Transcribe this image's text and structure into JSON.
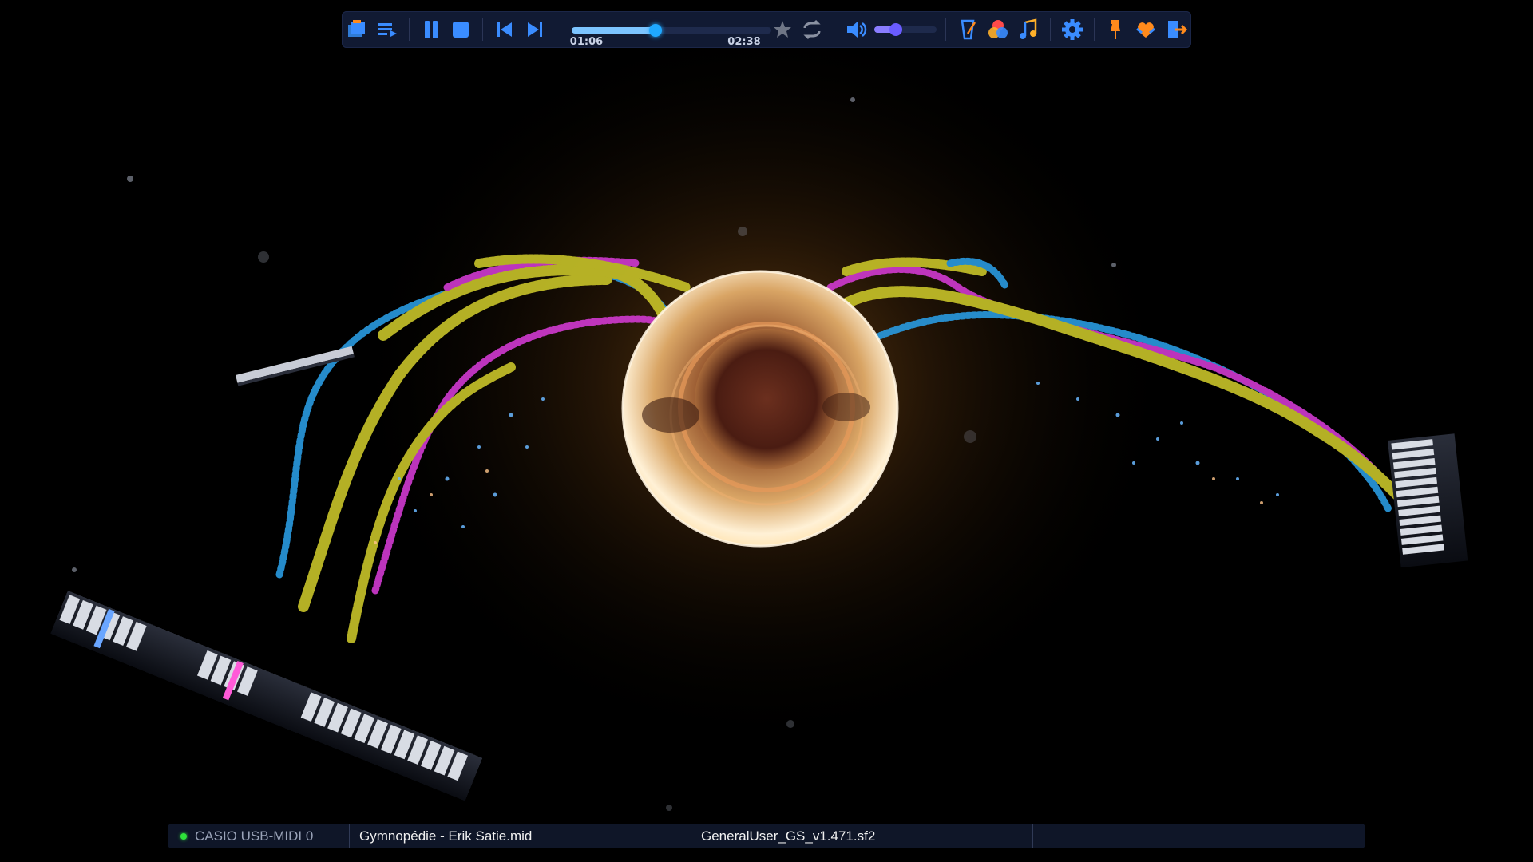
{
  "toolbar": {
    "time_current": "01:06",
    "time_total": "02:38",
    "progress": 0.42,
    "volume": 0.35,
    "buttons": [
      "open-files-icon",
      "playlist-icon",
      "pause-icon",
      "stop-icon",
      "previous-track-icon",
      "next-track-icon",
      "favorite-star-icon",
      "repeat-icon",
      "volume-speaker-icon",
      "tempo-metronome-icon",
      "color-palette-icon",
      "music-note-icon",
      "settings-gear-icon",
      "pin-icon",
      "support-heart-icon",
      "exit-icon"
    ],
    "colors": {
      "accent": "#1fa8ff",
      "bar": "#111a33",
      "orange": "#ff8a1c",
      "blue": "#3a8cff"
    }
  },
  "status": {
    "midi_device": "CASIO USB-MIDI 0",
    "midi_file": "Gymnopédie - Erik Satie.mid",
    "soundfont": "GeneralUser_GS_v1.471.sf2",
    "device_status_color": "#2ee33a"
  },
  "scene": {
    "ribbon_colors": [
      "#c8c42a",
      "#d13ad1",
      "#2a9be0"
    ],
    "orb_color": "#e8c28a"
  }
}
